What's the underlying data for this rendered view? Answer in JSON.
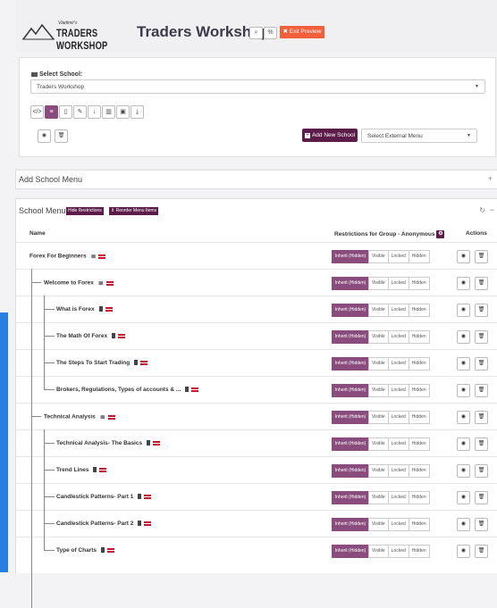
{
  "header": {
    "logo_small": "Vladimir's",
    "logo_big": "TRADERS WORKSHOP",
    "title": "Traders Workshop",
    "exit_preview": "✖ Exit Preview"
  },
  "school": {
    "label": "Select School:",
    "selected": "Traders Workshop",
    "add_new_school": "Add New School",
    "external_menu_placeholder": "Select External Menu"
  },
  "add_menu": {
    "title": "Add School Menu",
    "expand": "+"
  },
  "menu": {
    "title": "School Menu",
    "hide_restrictions": "Hide Restrictions",
    "reorder": "⇕ Reorder Menu Items",
    "col_name": "Name",
    "col_restrictions": "Restrictions for Group - Anonymous",
    "col_actions": "Actions",
    "options": [
      "Inherit (Hidden)",
      "Visible",
      "Locked",
      "Hidden"
    ],
    "items": [
      {
        "name": "Forex For Beginners",
        "icon": "list-icon",
        "level": 0
      },
      {
        "name": "Welcome to Forex",
        "icon": "list-icon",
        "level": 1
      },
      {
        "name": "What is Forex",
        "icon": "document-icon",
        "level": 2
      },
      {
        "name": "The Math Of Forex",
        "icon": "document-icon",
        "level": 2
      },
      {
        "name": "The Steps To Start Trading",
        "icon": "document-icon",
        "level": 2
      },
      {
        "name": "Brokers, Regulations, Types of accounts & ...",
        "icon": "document-icon",
        "level": 2
      },
      {
        "name": "Technical Analysis",
        "icon": "list-icon",
        "level": 1
      },
      {
        "name": "Technical Analysis- The Basics",
        "icon": "document-icon",
        "level": 2
      },
      {
        "name": "Trend Lines",
        "icon": "document-icon",
        "level": 2
      },
      {
        "name": "Candlestick Patterns- Part 1",
        "icon": "document-icon",
        "level": 2
      },
      {
        "name": "Candlestick Patterns- Part 2",
        "icon": "document-icon",
        "level": 2
      },
      {
        "name": "Type of Charts",
        "icon": "document-icon",
        "level": 2
      }
    ]
  },
  "colors": {
    "primary": "#5c1c4a",
    "selected_option": "#8a4c7d",
    "exit": "#f25f3a",
    "side_strip": "#2a7de1"
  }
}
